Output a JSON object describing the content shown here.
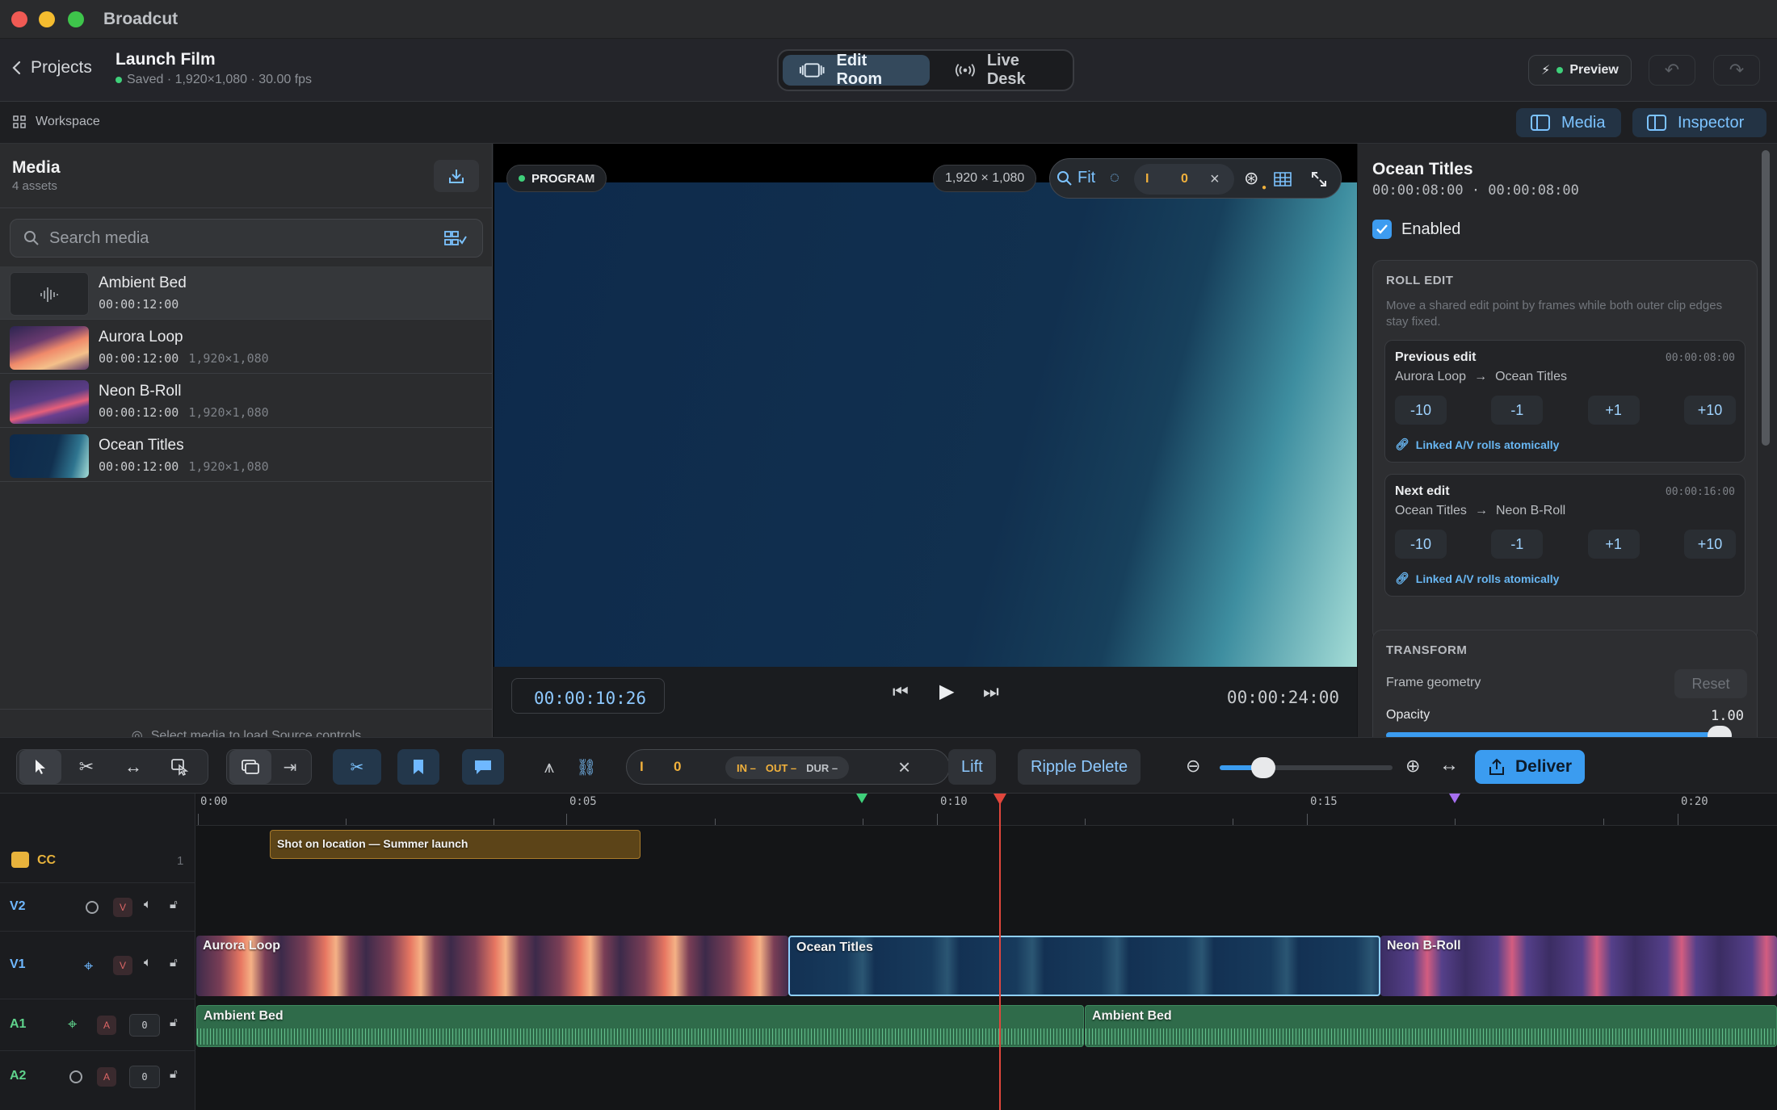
{
  "app": {
    "name": "Broadcut"
  },
  "header": {
    "back_label": "Projects",
    "project_title": "Launch Film",
    "project_status": "Saved · 1,920×1,080 · 30.00 fps",
    "modes": [
      {
        "label": "Edit Room"
      },
      {
        "label": "Live Desk"
      }
    ],
    "preview_label": "Preview"
  },
  "workspace": {
    "label": "Workspace",
    "media_toggle": "Media",
    "inspector_toggle": "Inspector"
  },
  "media": {
    "title": "Media",
    "count": "4 assets",
    "search_placeholder": "Search media",
    "assets": [
      {
        "name": "Ambient Bed",
        "timecode": "00:00:12:00",
        "resolution": ""
      },
      {
        "name": "Aurora Loop",
        "timecode": "00:00:12:00",
        "resolution": "1,920×1,080"
      },
      {
        "name": "Neon B-Roll",
        "timecode": "00:00:12:00",
        "resolution": "1,920×1,080"
      },
      {
        "name": "Ocean Titles",
        "timecode": "00:00:12:00",
        "resolution": "1,920×1,080"
      }
    ],
    "footer": "Select media to load Source controls"
  },
  "viewer": {
    "program_label": "PROGRAM",
    "resolution": "1,920 × 1,080",
    "fit_label": "Fit",
    "mark_value": "0",
    "timecode": "00:00:10:26",
    "duration": "00:00:24:00"
  },
  "inspector": {
    "clip_title": "Ocean Titles",
    "clip_timecodes": "00:00:08:00 · 00:00:08:00",
    "enabled_label": "Enabled",
    "roll_edit": {
      "heading": "ROLL EDIT",
      "description": "Move a shared edit point by frames while both outer clip edges stay fixed.",
      "previous": {
        "title": "Previous edit",
        "timecode": "00:00:08:00",
        "from": "Aurora Loop",
        "to": "Ocean Titles",
        "linked": "Linked A/V rolls atomically"
      },
      "next": {
        "title": "Next edit",
        "timecode": "00:00:16:00",
        "from": "Ocean Titles",
        "to": "Neon B-Roll",
        "linked": "Linked A/V rolls atomically"
      },
      "nudges": [
        "-10",
        "-1",
        "+1",
        "+10"
      ]
    },
    "transform": {
      "heading": "TRANSFORM",
      "frame_geometry": "Frame geometry",
      "reset": "Reset",
      "opacity_label": "Opacity",
      "opacity_value": "1.00",
      "opacity_fraction": 1.0
    }
  },
  "toolbar": {
    "mark_value": "0",
    "in_label": "IN –",
    "out_label": "OUT –",
    "dur_label": "DUR –",
    "lift": "Lift",
    "ripple_delete": "Ripple Delete",
    "zoom_fraction": 0.25,
    "deliver": "Deliver"
  },
  "timeline": {
    "ruler_labels": [
      "0:00",
      "0:05",
      "0:10",
      "0:15",
      "0:20"
    ],
    "tracks": [
      {
        "name": "CC",
        "count": "1",
        "color": "#e8b33c"
      },
      {
        "name": "V2",
        "color": "#6fb8ff"
      },
      {
        "name": "V1",
        "color": "#6fb8ff"
      },
      {
        "name": "A1",
        "color": "#5fd38c",
        "level": "0"
      },
      {
        "name": "A2",
        "color": "#5fd38c",
        "level": "0"
      }
    ],
    "caption": "Shot on location — Summer launch",
    "v1_clips": [
      "Aurora Loop",
      "Ocean Titles",
      "Neon B-Roll"
    ],
    "a1_clips": [
      "Ambient Bed",
      "Ambient Bed"
    ]
  },
  "colors": {
    "accent": "#3b9cf0",
    "playhead": "#e0463c",
    "audio_clip": "#2f6b4a",
    "caption_clip": "#5c4418"
  }
}
